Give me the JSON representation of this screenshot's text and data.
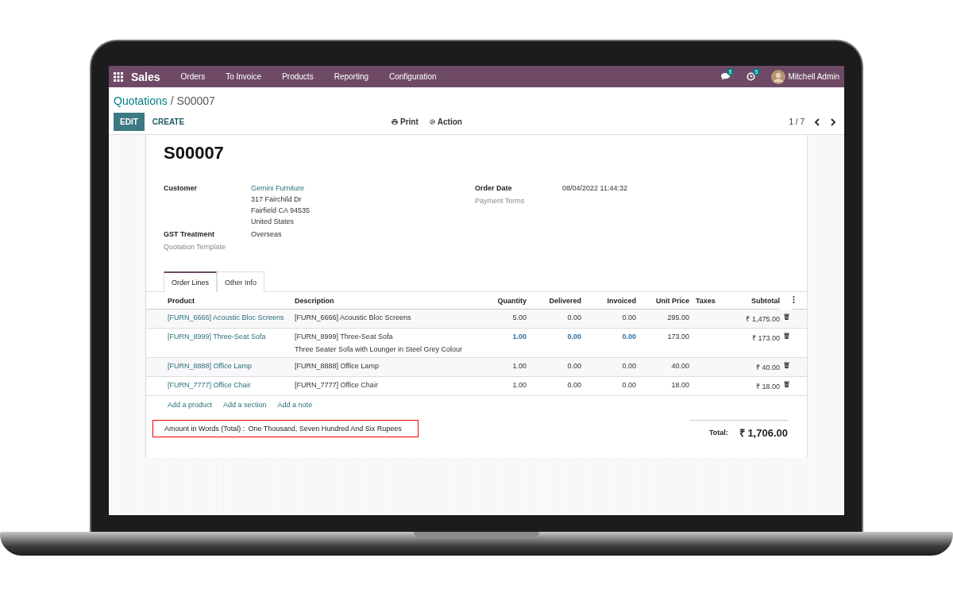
{
  "navbar": {
    "app": "Sales",
    "menu": [
      "Orders",
      "To Invoice",
      "Products",
      "Reporting",
      "Configuration"
    ],
    "messages_badge": "5",
    "activities_badge": "5",
    "user": "Mitchell Admin"
  },
  "breadcrumb": {
    "parent": "Quotations",
    "separator": "/",
    "current": "S00007"
  },
  "buttons": {
    "edit": "EDIT",
    "create": "CREATE",
    "print": "Print",
    "action": "Action"
  },
  "pager": "1 / 7",
  "record": {
    "name": "S00007",
    "fields_left": [
      {
        "label": "Customer",
        "kind": "link",
        "values": [
          "Gemini Furniture",
          "317 Fairchild Dr",
          "Fairfield CA 94535",
          "United States"
        ]
      },
      {
        "label": "GST Treatment",
        "kind": "text",
        "values": [
          "Overseas"
        ]
      },
      {
        "label": "Quotation Template",
        "kind": "empty"
      }
    ],
    "fields_right": [
      {
        "label": "Order Date",
        "kind": "text",
        "values": [
          "08/04/2022 11:44:32"
        ]
      },
      {
        "label": "Payment Terms",
        "kind": "empty"
      }
    ]
  },
  "tabs": [
    {
      "label": "Order Lines",
      "selected": true
    },
    {
      "label": "Other Info",
      "selected": false
    }
  ],
  "table": {
    "columns": [
      "Product",
      "Description",
      "Quantity",
      "Delivered",
      "Invoiced",
      "Unit Price",
      "Taxes",
      "Subtotal"
    ],
    "rows": [
      {
        "product": "[FURN_6666] Acoustic Bloc Screens",
        "description": [
          "[FURN_6666] Acoustic Bloc Screens"
        ],
        "quantity": "5.00",
        "delivered": "0.00",
        "invoiced": "0.00",
        "unit_price": "295.00",
        "subtotal": "₹ 1,475.00",
        "highlighted": false
      },
      {
        "product": "[FURN_8999] Three-Seat Sofa",
        "description": [
          "[FURN_8999] Three-Seat Sofa",
          "Three Seater Sofa with Lounger in Steel Grey Colour"
        ],
        "quantity": "1.00",
        "delivered": "0.00",
        "invoiced": "0.00",
        "unit_price": "173.00",
        "subtotal": "₹ 173.00",
        "highlighted": true
      },
      {
        "product": "[FURN_8888] Office Lamp",
        "description": [
          "[FURN_8888] Office Lamp"
        ],
        "quantity": "1.00",
        "delivered": "0.00",
        "invoiced": "0.00",
        "unit_price": "40.00",
        "subtotal": "₹ 40.00",
        "highlighted": false
      },
      {
        "product": "[FURN_7777] Office Chair",
        "description": [
          "[FURN_7777] Office Chair"
        ],
        "quantity": "1.00",
        "delivered": "0.00",
        "invoiced": "0.00",
        "unit_price": "18.00",
        "subtotal": "₹ 18.00",
        "highlighted": false
      }
    ],
    "add_links": [
      "Add a product",
      "Add a section",
      "Add a note"
    ]
  },
  "amount_in_words": {
    "label": "Amount in Words (Total) :",
    "value": "One Thousand, Seven Hundred And Six Rupees"
  },
  "total": {
    "label": "Total:",
    "value": "₹ 1,706.00"
  }
}
